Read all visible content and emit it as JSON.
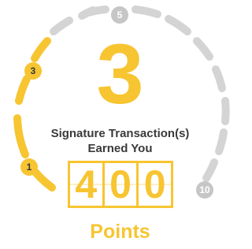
{
  "colors": {
    "accent": "#f7c531",
    "track": "#d4d4d4",
    "marker_active": "#f7c531",
    "marker_inactive": "#c6c6c6",
    "marker_text_active": "#3a3a3a",
    "marker_text_inactive": "#ffffff",
    "caption": "#3a3a3a"
  },
  "progress": {
    "transactions_earned": "3",
    "milestones": [
      {
        "label": "1",
        "reached": true
      },
      {
        "label": "3",
        "reached": true
      },
      {
        "label": "5",
        "reached": false
      },
      {
        "label": "10",
        "reached": false
      }
    ]
  },
  "caption": {
    "line1": "Signature Transaction(s)",
    "line2": "Earned You"
  },
  "points": {
    "digits": [
      "4",
      "0",
      "0"
    ],
    "label": "Points"
  }
}
